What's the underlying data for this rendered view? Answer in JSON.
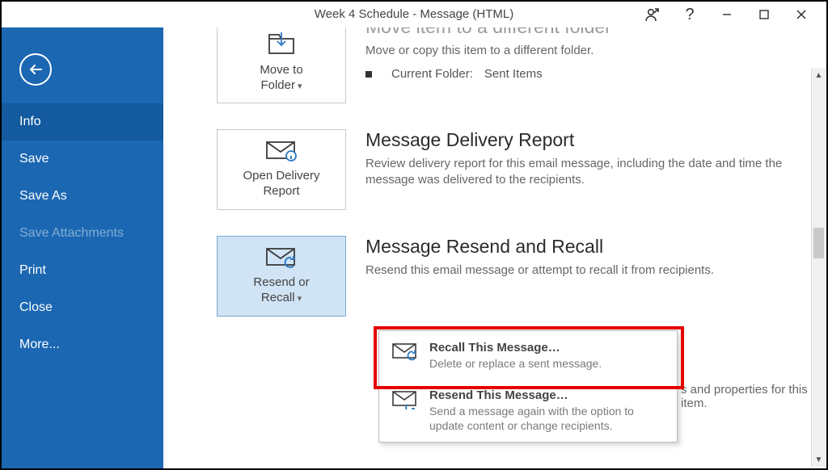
{
  "title": "Week 4 Schedule   -   Message (HTML)",
  "sidebar": {
    "items": [
      {
        "label": "Info",
        "selected": true,
        "disabled": false
      },
      {
        "label": "Save",
        "selected": false,
        "disabled": false
      },
      {
        "label": "Save As",
        "selected": false,
        "disabled": false
      },
      {
        "label": "Save Attachments",
        "selected": false,
        "disabled": true
      },
      {
        "label": "Print",
        "selected": false,
        "disabled": false
      },
      {
        "label": "Close",
        "selected": false,
        "disabled": false
      },
      {
        "label": "More...",
        "selected": false,
        "disabled": false
      }
    ]
  },
  "sections": {
    "move": {
      "tile_line1": "Move to",
      "tile_line2": "Folder",
      "heading": "Move item to a different folder",
      "desc": "Move or copy this item to a different folder.",
      "current_label": "Current Folder:",
      "current_value": "Sent Items"
    },
    "delivery": {
      "tile_line1": "Open Delivery",
      "tile_line2": "Report",
      "heading": "Message Delivery Report",
      "desc": "Review delivery report for this email message, including the date and time the message was delivered to the recipients."
    },
    "recall": {
      "tile_line1": "Resend or",
      "tile_line2": "Recall",
      "heading": "Message Resend and Recall",
      "desc": "Resend this email message or attempt to recall it from recipients."
    },
    "properties_trail": "s and properties for this item."
  },
  "menu": {
    "recall": {
      "title": "Recall This Message…",
      "desc": "Delete or replace a sent message."
    },
    "resend": {
      "title": "Resend This Message…",
      "desc": "Send a message again with the option to update content or change recipients."
    }
  }
}
